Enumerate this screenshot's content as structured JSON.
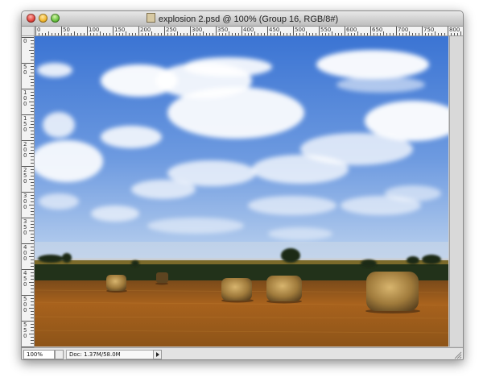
{
  "window": {
    "title": "explosion 2.psd @ 100% (Group 16, RGB/8#)"
  },
  "ruler": {
    "horizontal_labels": [
      "0",
      "50",
      "100",
      "150",
      "200",
      "250",
      "300",
      "350",
      "400",
      "450",
      "500",
      "550",
      "600",
      "650",
      "700",
      "750",
      "800"
    ],
    "vertical_labels": [
      "0",
      "50",
      "100",
      "150",
      "200",
      "250",
      "300",
      "350",
      "400",
      "450",
      "500",
      "550",
      "600"
    ]
  },
  "canvas": {
    "description_icon": "photo-canvas",
    "sky_top_color": "#3f78d6",
    "sky_bottom_color": "#a9c6ea",
    "field_color": "#9a5a1c",
    "treeline_color": "#23331a"
  },
  "status": {
    "zoom": "100%",
    "doc_info": "Doc: 1.37M/58.0M"
  },
  "icons": {
    "close": "close-icon",
    "minimize": "minimize-icon",
    "zoom": "zoom-icon",
    "document": "document-icon",
    "arrow": "arrow-right-icon",
    "resize": "resize-grip-icon"
  }
}
